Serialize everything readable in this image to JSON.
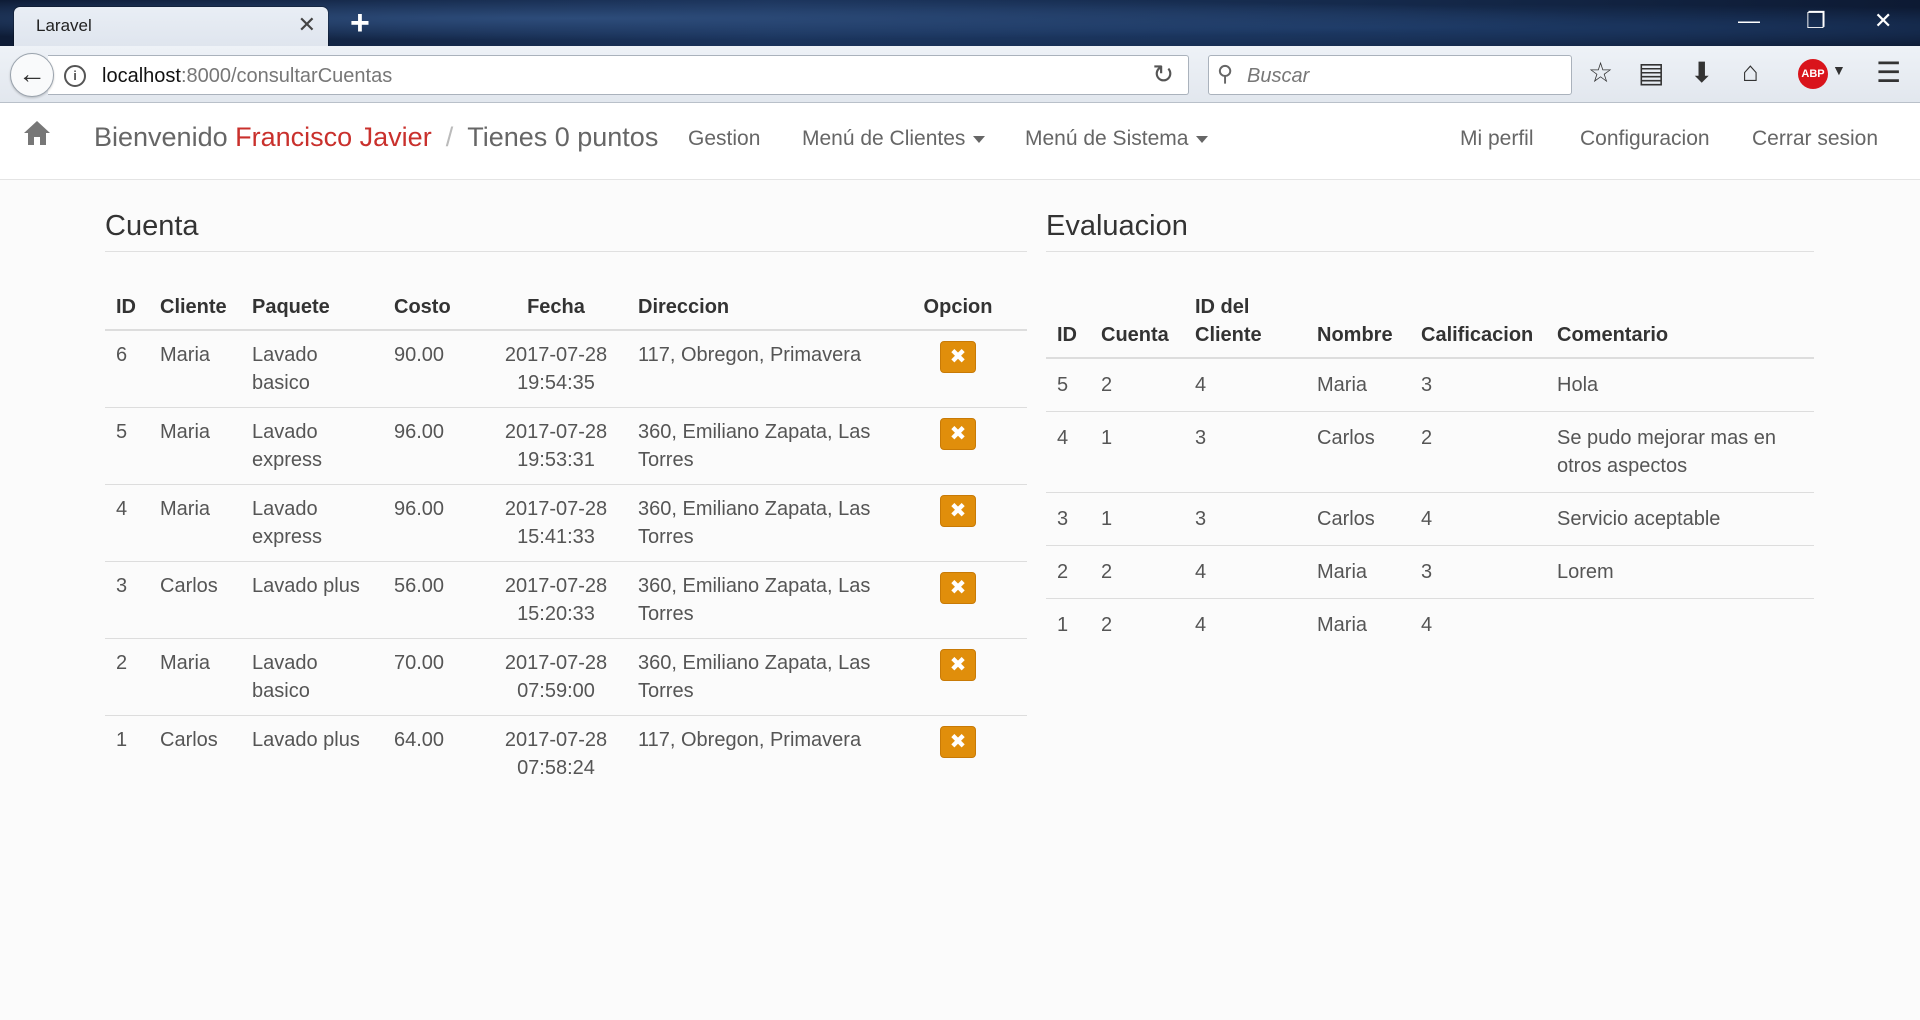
{
  "browser": {
    "tab_title": "Laravel",
    "url_host": "localhost",
    "url_path": ":8000/consultarCuentas",
    "search_placeholder": "Buscar",
    "abp_label": "ABP"
  },
  "navbar": {
    "welcome": "Bienvenido",
    "user_name": "Francisco Javier",
    "separator": "/",
    "points": "Tienes 0 puntos",
    "gestion": "Gestion",
    "menu_clientes": "Menú de Clientes",
    "menu_sistema": "Menú de Sistema",
    "mi_perfil": "Mi perfil",
    "configuracion": "Configuracion",
    "cerrar_sesion": "Cerrar sesion"
  },
  "cuenta": {
    "title": "Cuenta",
    "headers": [
      "ID",
      "Cliente",
      "Paquete",
      "Costo",
      "Fecha",
      "Direccion",
      "Opcion"
    ],
    "rows": [
      {
        "id": "6",
        "cliente": "Maria",
        "paquete": "Lavado basico",
        "costo": "90.00",
        "fecha": "2017-07-28 19:54:35",
        "direccion": "117, Obregon, Primavera"
      },
      {
        "id": "5",
        "cliente": "Maria",
        "paquete": "Lavado express",
        "costo": "96.00",
        "fecha": "2017-07-28 19:53:31",
        "direccion": "360, Emiliano Zapata, Las Torres"
      },
      {
        "id": "4",
        "cliente": "Maria",
        "paquete": "Lavado express",
        "costo": "96.00",
        "fecha": "2017-07-28 15:41:33",
        "direccion": "360, Emiliano Zapata, Las Torres"
      },
      {
        "id": "3",
        "cliente": "Carlos",
        "paquete": "Lavado plus",
        "costo": "56.00",
        "fecha": "2017-07-28 15:20:33",
        "direccion": "360, Emiliano Zapata, Las Torres"
      },
      {
        "id": "2",
        "cliente": "Maria",
        "paquete": "Lavado basico",
        "costo": "70.00",
        "fecha": "2017-07-28 07:59:00",
        "direccion": "360, Emiliano Zapata, Las Torres"
      },
      {
        "id": "1",
        "cliente": "Carlos",
        "paquete": "Lavado plus",
        "costo": "64.00",
        "fecha": "2017-07-28 07:58:24",
        "direccion": "117, Obregon, Primavera"
      }
    ],
    "delete_glyph": "✖"
  },
  "evaluacion": {
    "title": "Evaluacion",
    "headers": [
      "ID",
      "Cuenta",
      "ID del Cliente",
      "Nombre",
      "Calificacion",
      "Comentario"
    ],
    "rows": [
      {
        "id": "5",
        "cuenta": "2",
        "id_cliente": "4",
        "nombre": "Maria",
        "calificacion": "3",
        "comentario": "Hola"
      },
      {
        "id": "4",
        "cuenta": "1",
        "id_cliente": "3",
        "nombre": "Carlos",
        "calificacion": "2",
        "comentario": "Se pudo mejorar mas en otros aspectos"
      },
      {
        "id": "3",
        "cuenta": "1",
        "id_cliente": "3",
        "nombre": "Carlos",
        "calificacion": "4",
        "comentario": "Servicio aceptable"
      },
      {
        "id": "2",
        "cuenta": "2",
        "id_cliente": "4",
        "nombre": "Maria",
        "calificacion": "3",
        "comentario": "Lorem"
      },
      {
        "id": "1",
        "cuenta": "2",
        "id_cliente": "4",
        "nombre": "Maria",
        "calificacion": "4",
        "comentario": ""
      }
    ]
  },
  "colors": {
    "accent_name": "#c9302c",
    "delete_button": "#e08e0b"
  }
}
